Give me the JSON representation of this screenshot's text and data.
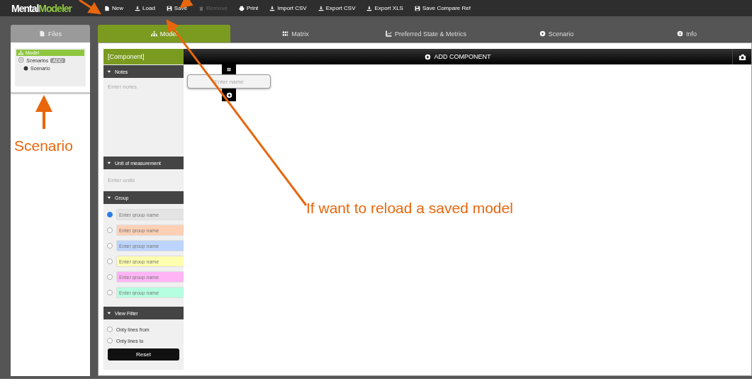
{
  "logo": {
    "part_1": "Mental",
    "part_2": "Modeler"
  },
  "toolbar": [
    {
      "label": "New",
      "disabled": false
    },
    {
      "label": "Load",
      "disabled": false
    },
    {
      "label": "Save",
      "disabled": false
    },
    {
      "label": "Remove",
      "disabled": true
    },
    {
      "label": "Print",
      "disabled": false
    },
    {
      "label": "Import CSV",
      "disabled": false
    },
    {
      "label": "Export CSV",
      "disabled": false
    },
    {
      "label": "Export XLS",
      "disabled": false
    },
    {
      "label": "Save Compare Ref",
      "disabled": false
    }
  ],
  "files_tab": {
    "label": "Files"
  },
  "tabs": [
    {
      "label": "Model",
      "selected": true
    },
    {
      "label": "Matrix",
      "selected": false
    },
    {
      "label": "Preferred State & Metrics",
      "selected": false
    },
    {
      "label": "Scenario",
      "selected": false
    },
    {
      "label": "Info",
      "selected": false
    }
  ],
  "files": {
    "model": {
      "label": "Model",
      "selected": true
    },
    "scenarios": {
      "label": "Scenarios",
      "badge": "ADD",
      "expanded": true,
      "children": [
        {
          "label": "Scenario"
        }
      ]
    }
  },
  "editor": {
    "title": "[Component]",
    "notes": {
      "heading": "Notes",
      "placeholder": "Enter notes"
    },
    "unit": {
      "heading": "Unit of measurement",
      "placeholder": "Enter units"
    },
    "group": {
      "heading": "Group",
      "items": [
        {
          "placeholder": "Enter group name",
          "color": "#e4e4e4",
          "selected": true
        },
        {
          "placeholder": "Enter group name",
          "color": "#ffd0b5",
          "selected": false
        },
        {
          "placeholder": "Enter group name",
          "color": "#bcd4ff",
          "selected": false
        },
        {
          "placeholder": "Enter group name",
          "color": "#ffffb0",
          "selected": false
        },
        {
          "placeholder": "Enter group name",
          "color": "#ffb5f5",
          "selected": false
        },
        {
          "placeholder": "Enter group name",
          "color": "#b5ffe0",
          "selected": false
        }
      ]
    },
    "view_filter": {
      "heading": "View Filter",
      "options": [
        {
          "label": "Only lines from",
          "selected": false
        },
        {
          "label": "Only lines to",
          "selected": false
        }
      ],
      "reset": "Reset"
    }
  },
  "canvas": {
    "add_component": "ADD COMPONENT",
    "node": {
      "placeholder": "Enter name"
    }
  },
  "annotations": [
    {
      "text": "Scenario"
    },
    {
      "text": "If want to reload a saved model"
    }
  ]
}
